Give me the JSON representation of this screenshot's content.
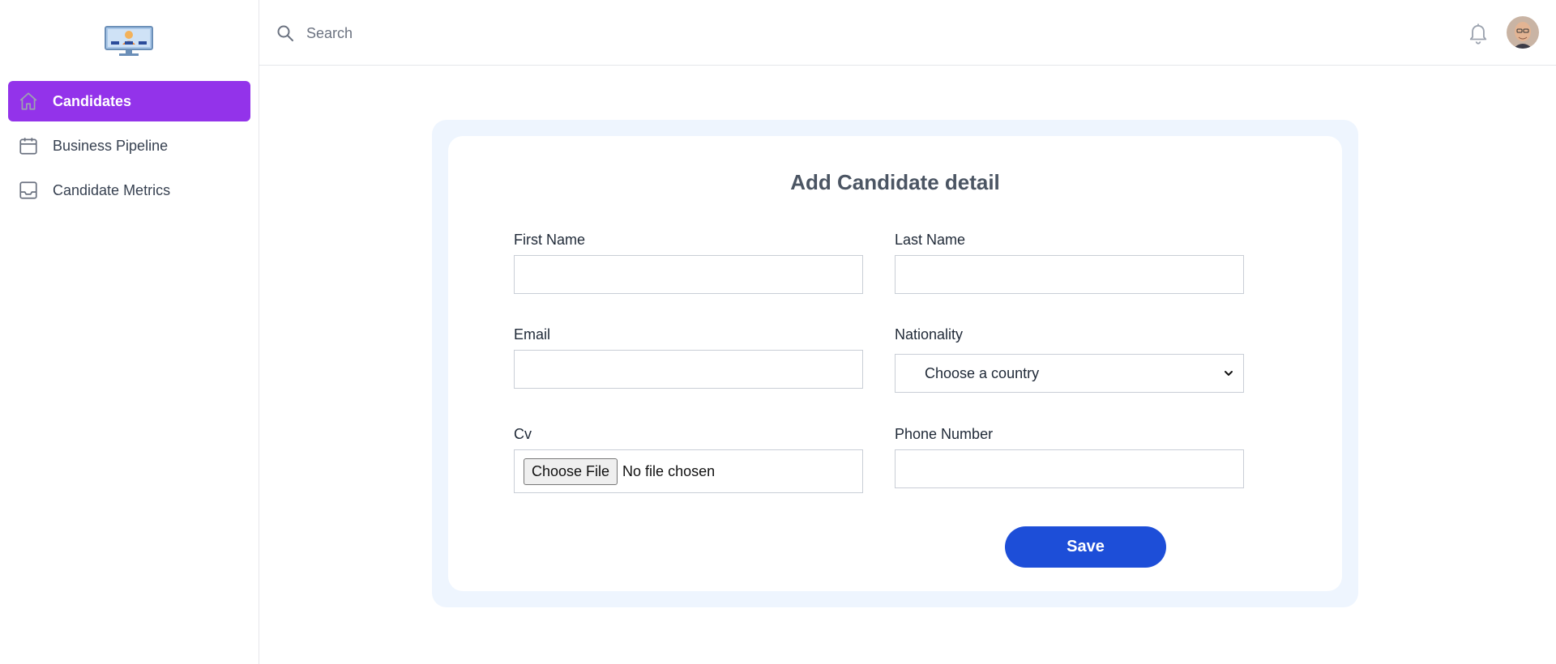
{
  "sidebar": {
    "items": [
      {
        "label": "Candidates",
        "icon": "home-icon",
        "active": true
      },
      {
        "label": "Business Pipeline",
        "icon": "calendar-icon",
        "active": false
      },
      {
        "label": "Candidate Metrics",
        "icon": "inbox-icon",
        "active": false
      }
    ]
  },
  "header": {
    "search_placeholder": "Search"
  },
  "form": {
    "title": "Add Candidate detail",
    "first_name_label": "First Name",
    "last_name_label": "Last Name",
    "email_label": "Email",
    "nationality_label": "Nationality",
    "nationality_value": "Choose a country",
    "cv_label": "Cv",
    "cv_button": "Choose File",
    "cv_status": "No file chosen",
    "phone_label": "Phone Number",
    "save_label": "Save"
  },
  "colors": {
    "accent_purple": "#9333ea",
    "save_blue": "#1d4ed8",
    "card_bg": "#eef5fe"
  }
}
